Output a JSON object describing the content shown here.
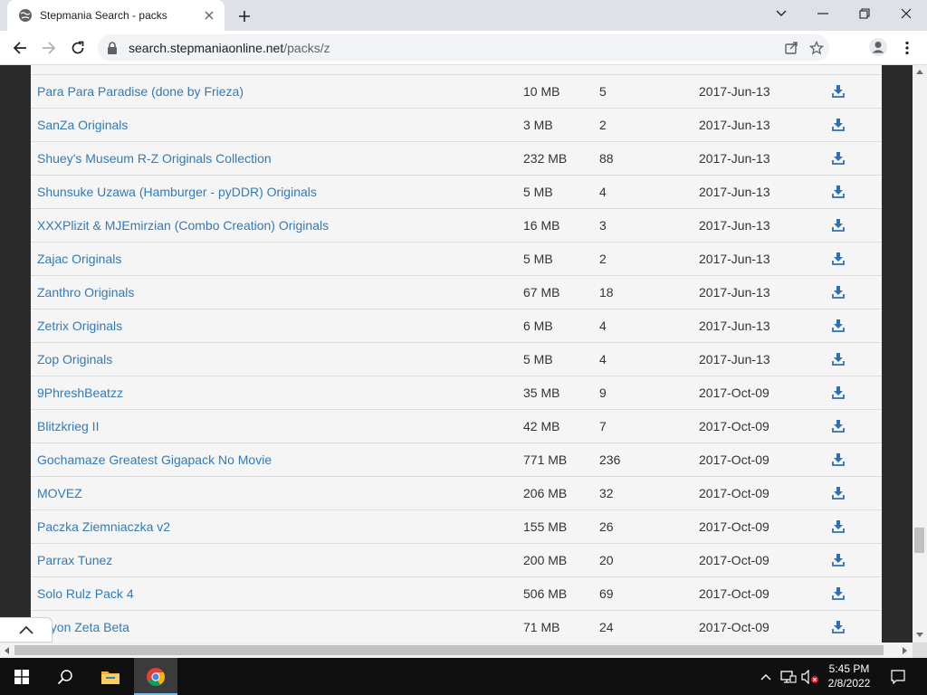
{
  "browser": {
    "tab_title": "Stepmania Search - packs",
    "url_domain": "search.stepmaniaonline.net",
    "url_path": "/packs/z"
  },
  "packs": [
    {
      "name": "Para Para Paradise (done by Frieza)",
      "size": "10 MB",
      "songs": "5",
      "date": "2017-Jun-13"
    },
    {
      "name": "SanZa Originals",
      "size": "3 MB",
      "songs": "2",
      "date": "2017-Jun-13"
    },
    {
      "name": "Shuey's Museum R-Z Originals Collection",
      "size": "232 MB",
      "songs": "88",
      "date": "2017-Jun-13"
    },
    {
      "name": "Shunsuke Uzawa (Hamburger - pyDDR) Originals",
      "size": "5 MB",
      "songs": "4",
      "date": "2017-Jun-13"
    },
    {
      "name": "XXXPlizit & MJEmirzian (Combo Creation) Originals",
      "size": "16 MB",
      "songs": "3",
      "date": "2017-Jun-13"
    },
    {
      "name": "Zajac Originals",
      "size": "5 MB",
      "songs": "2",
      "date": "2017-Jun-13"
    },
    {
      "name": "Zanthro Originals",
      "size": "67 MB",
      "songs": "18",
      "date": "2017-Jun-13"
    },
    {
      "name": "Zetrix Originals",
      "size": "6 MB",
      "songs": "4",
      "date": "2017-Jun-13"
    },
    {
      "name": "Zop Originals",
      "size": "5 MB",
      "songs": "4",
      "date": "2017-Jun-13"
    },
    {
      "name": "9PhreshBeatzz",
      "size": "35 MB",
      "songs": "9",
      "date": "2017-Oct-09"
    },
    {
      "name": "Blitzkrieg II",
      "size": "42 MB",
      "songs": "7",
      "date": "2017-Oct-09"
    },
    {
      "name": "Gochamaze Greatest Gigapack No Movie",
      "size": "771 MB",
      "songs": "236",
      "date": "2017-Oct-09"
    },
    {
      "name": "MOVEZ",
      "size": "206 MB",
      "songs": "32",
      "date": "2017-Oct-09"
    },
    {
      "name": "Paczka Ziemniaczka v2",
      "size": "155 MB",
      "songs": "26",
      "date": "2017-Oct-09"
    },
    {
      "name": "Parrax Tunez",
      "size": "200 MB",
      "songs": "20",
      "date": "2017-Oct-09"
    },
    {
      "name": "Solo Rulz Pack 4",
      "size": "506 MB",
      "songs": "69",
      "date": "2017-Oct-09"
    },
    {
      "name": "chyon Zeta Beta",
      "size": "71 MB",
      "songs": "24",
      "date": "2017-Oct-09"
    }
  ],
  "taskbar": {
    "time": "5:45 PM",
    "date": "2/8/2022"
  },
  "colors": {
    "link": "#337ab7",
    "download_icon": "#2f6fb3",
    "page_bg": "#f5f5f5",
    "side_bg": "#2b2b2b"
  }
}
